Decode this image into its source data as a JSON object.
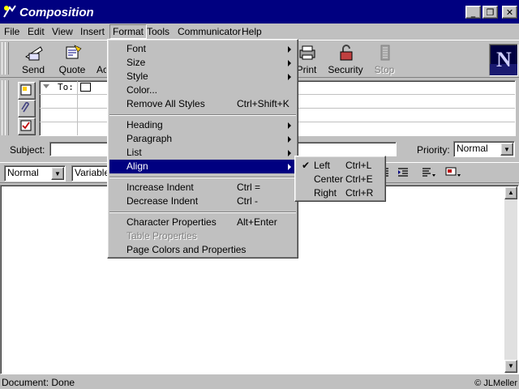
{
  "window": {
    "title": "Composition"
  },
  "menubar": [
    "File",
    "Edit",
    "View",
    "Insert",
    "Format",
    "Tools",
    "Communicator",
    "Help"
  ],
  "toolbar": {
    "buttons": [
      {
        "label": "Send",
        "icon": "send-icon"
      },
      {
        "label": "Quote",
        "icon": "quote-icon"
      },
      {
        "label": "Ac",
        "icon": "address-icon"
      },
      {
        "label": "Print",
        "icon": "print-icon"
      },
      {
        "label": "Security",
        "icon": "security-icon"
      },
      {
        "label": "Stop",
        "icon": "stop-icon",
        "disabled": true
      }
    ]
  },
  "address": {
    "to_label": "To:"
  },
  "subject": {
    "label": "Subject:",
    "value": ""
  },
  "priority": {
    "label": "Priority:",
    "value": "Normal"
  },
  "format_bar": {
    "paragraph_style": "Normal",
    "font": "Variable"
  },
  "format_menu": {
    "items": [
      {
        "label": "Font",
        "submenu": true
      },
      {
        "label": "Size",
        "submenu": true
      },
      {
        "label": "Style",
        "submenu": true
      },
      {
        "label": "Color..."
      },
      {
        "label": "Remove All Styles",
        "shortcut": "Ctrl+Shift+K"
      },
      {
        "label": "Heading",
        "submenu": true
      },
      {
        "label": "Paragraph",
        "submenu": true
      },
      {
        "label": "List",
        "submenu": true
      },
      {
        "label": "Align",
        "submenu": true,
        "highlighted": true
      },
      {
        "label": "Increase Indent",
        "shortcut": "Ctrl ="
      },
      {
        "label": "Decrease Indent",
        "shortcut": "Ctrl -"
      },
      {
        "label": "Character Properties",
        "shortcut": "Alt+Enter"
      },
      {
        "label": "Table Properties",
        "disabled": true
      },
      {
        "label": "Page Colors and Properties"
      }
    ]
  },
  "align_menu": {
    "items": [
      {
        "label": "Left",
        "shortcut": "Ctrl+L",
        "checked": true
      },
      {
        "label": "Center",
        "shortcut": "Ctrl+E"
      },
      {
        "label": "Right",
        "shortcut": "Ctrl+R"
      }
    ]
  },
  "status": {
    "text": "Document: Done",
    "copyright": "© JLMeller"
  },
  "colors": {
    "titlebar": "#000080",
    "face": "#c0c0c0",
    "highlight": "#000080"
  }
}
